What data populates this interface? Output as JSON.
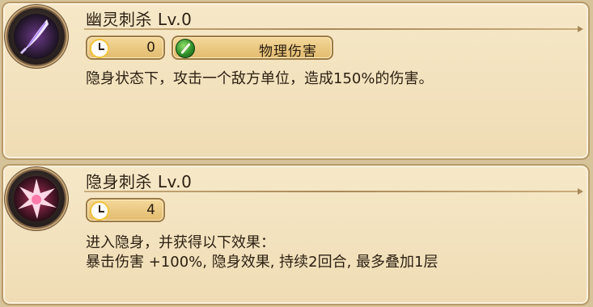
{
  "skills": [
    {
      "name": "幽灵刺杀 Lv.0",
      "cooldown": "0",
      "damage_type": "物理伤害",
      "description_lines": [
        "隐身状态下，攻击一个敌方单位，造成150%的伤害。"
      ]
    },
    {
      "name": "隐身刺杀 Lv.0",
      "cooldown": "4",
      "description_lines": [
        "进入隐身，并获得以下效果：",
        "暴击伤害 +100%, 隐身效果, 持续2回合, 最多叠加1层"
      ]
    }
  ],
  "icons": {
    "skill1": "ghost-blade-icon",
    "skill2": "stealth-burst-icon",
    "cooldown": "clock-icon",
    "damage": "sword-icon"
  },
  "colors": {
    "card_bg": "#f6e8c8",
    "border": "#b89b6a",
    "pill": "#e2bb6e"
  }
}
